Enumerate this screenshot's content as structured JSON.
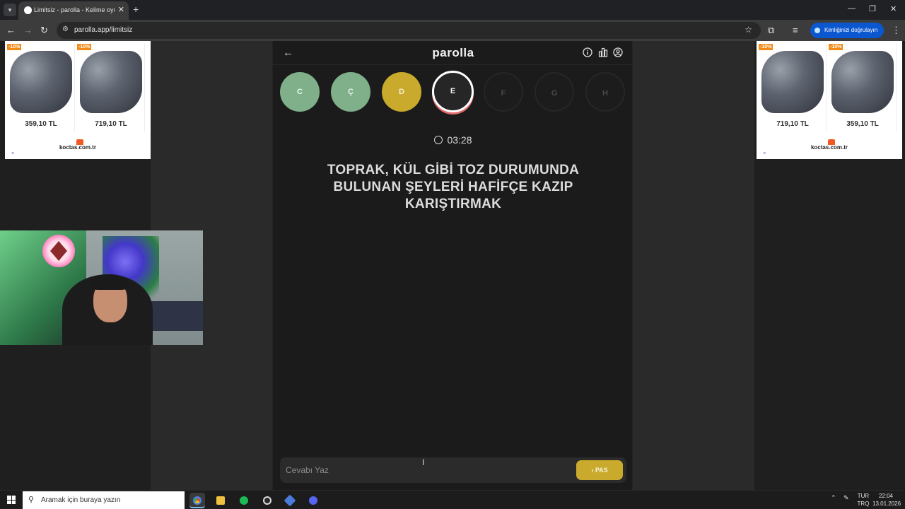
{
  "browser": {
    "tab_title": "Limitsiz - parolla - Kelime oyunu",
    "url": "parolla.app/limitsiz",
    "profile_label": "Kimliğinizi doğrulayın"
  },
  "ads": {
    "left": {
      "prices": [
        "359,10 TL",
        "719,10 TL"
      ],
      "badge": "-10%",
      "brand": "koctas.com.tr"
    },
    "right": {
      "prices": [
        "719,10 TL",
        "359,10 TL"
      ],
      "badge": "-10%",
      "brand": "koctas.com.tr"
    }
  },
  "game": {
    "logo": "parolla",
    "letters": [
      {
        "letter": "C",
        "state": "correct"
      },
      {
        "letter": "Ç",
        "state": "correct"
      },
      {
        "letter": "D",
        "state": "passed"
      },
      {
        "letter": "E",
        "state": "current"
      },
      {
        "letter": "F",
        "state": "pending"
      },
      {
        "letter": "G",
        "state": "pending"
      },
      {
        "letter": "H",
        "state": "pending"
      }
    ],
    "timer": "03:28",
    "question": "TOPRAK, KÜL GİBİ TOZ DURUMUNDA BULUNAN ŞEYLERİ HAFİFÇE KAZIP KARIŞTIRMAK",
    "answer_placeholder": "Cevabı Yaz",
    "pass_label": "PAS"
  },
  "taskbar": {
    "search_placeholder": "Aramak için buraya yazın",
    "lang_top": "TUR",
    "lang_bottom": "TRQ",
    "time": "22:04",
    "date": "13.01.2026"
  },
  "colors": {
    "correct": "#7fb08a",
    "passed": "#c9aa2d",
    "current_ring": "#ffffff",
    "current_underline": "#e36b6b",
    "profile_button": "#0b57d0"
  }
}
